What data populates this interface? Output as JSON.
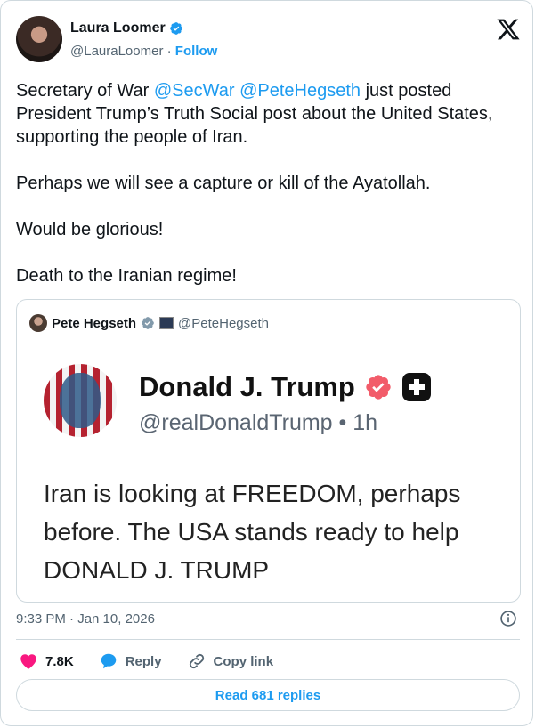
{
  "author": {
    "name": "Laura Loomer",
    "handle": "@LauraLoomer",
    "separator": "·",
    "follow_label": "Follow"
  },
  "post": {
    "p1_pre": "Secretary of War ",
    "p1_mention1": "@SecWar",
    "p1_space": " ",
    "p1_mention2": "@PeteHegseth",
    "p1_post": " just posted President Trump’s Truth Social post about the United States, supporting the people of Iran.",
    "p2": "Perhaps we will see a capture or kill of the Ayatollah.",
    "p3": "Would be glorious!",
    "p4": "Death to the Iranian regime!"
  },
  "quote": {
    "name": "Pete Hegseth",
    "handle": "@PeteHegseth",
    "embed": {
      "name": "Donald J. Trump",
      "handle": "@realDonaldTrump",
      "time": "• 1h",
      "lines": [
        "Iran is looking at FREEDOM, perhaps",
        "before. The USA stands ready to help",
        "DONALD J. TRUMP"
      ]
    }
  },
  "timestamp": "9:33 PM · Jan 10, 2026",
  "actions": {
    "likes": "7.8K",
    "reply_label": "Reply",
    "copy_label": "Copy link"
  },
  "read_replies_label": "Read 681 replies",
  "colors": {
    "accent": "#1d9bf0",
    "like": "#f91880",
    "text": "#0f1419",
    "secondary": "#536471"
  }
}
